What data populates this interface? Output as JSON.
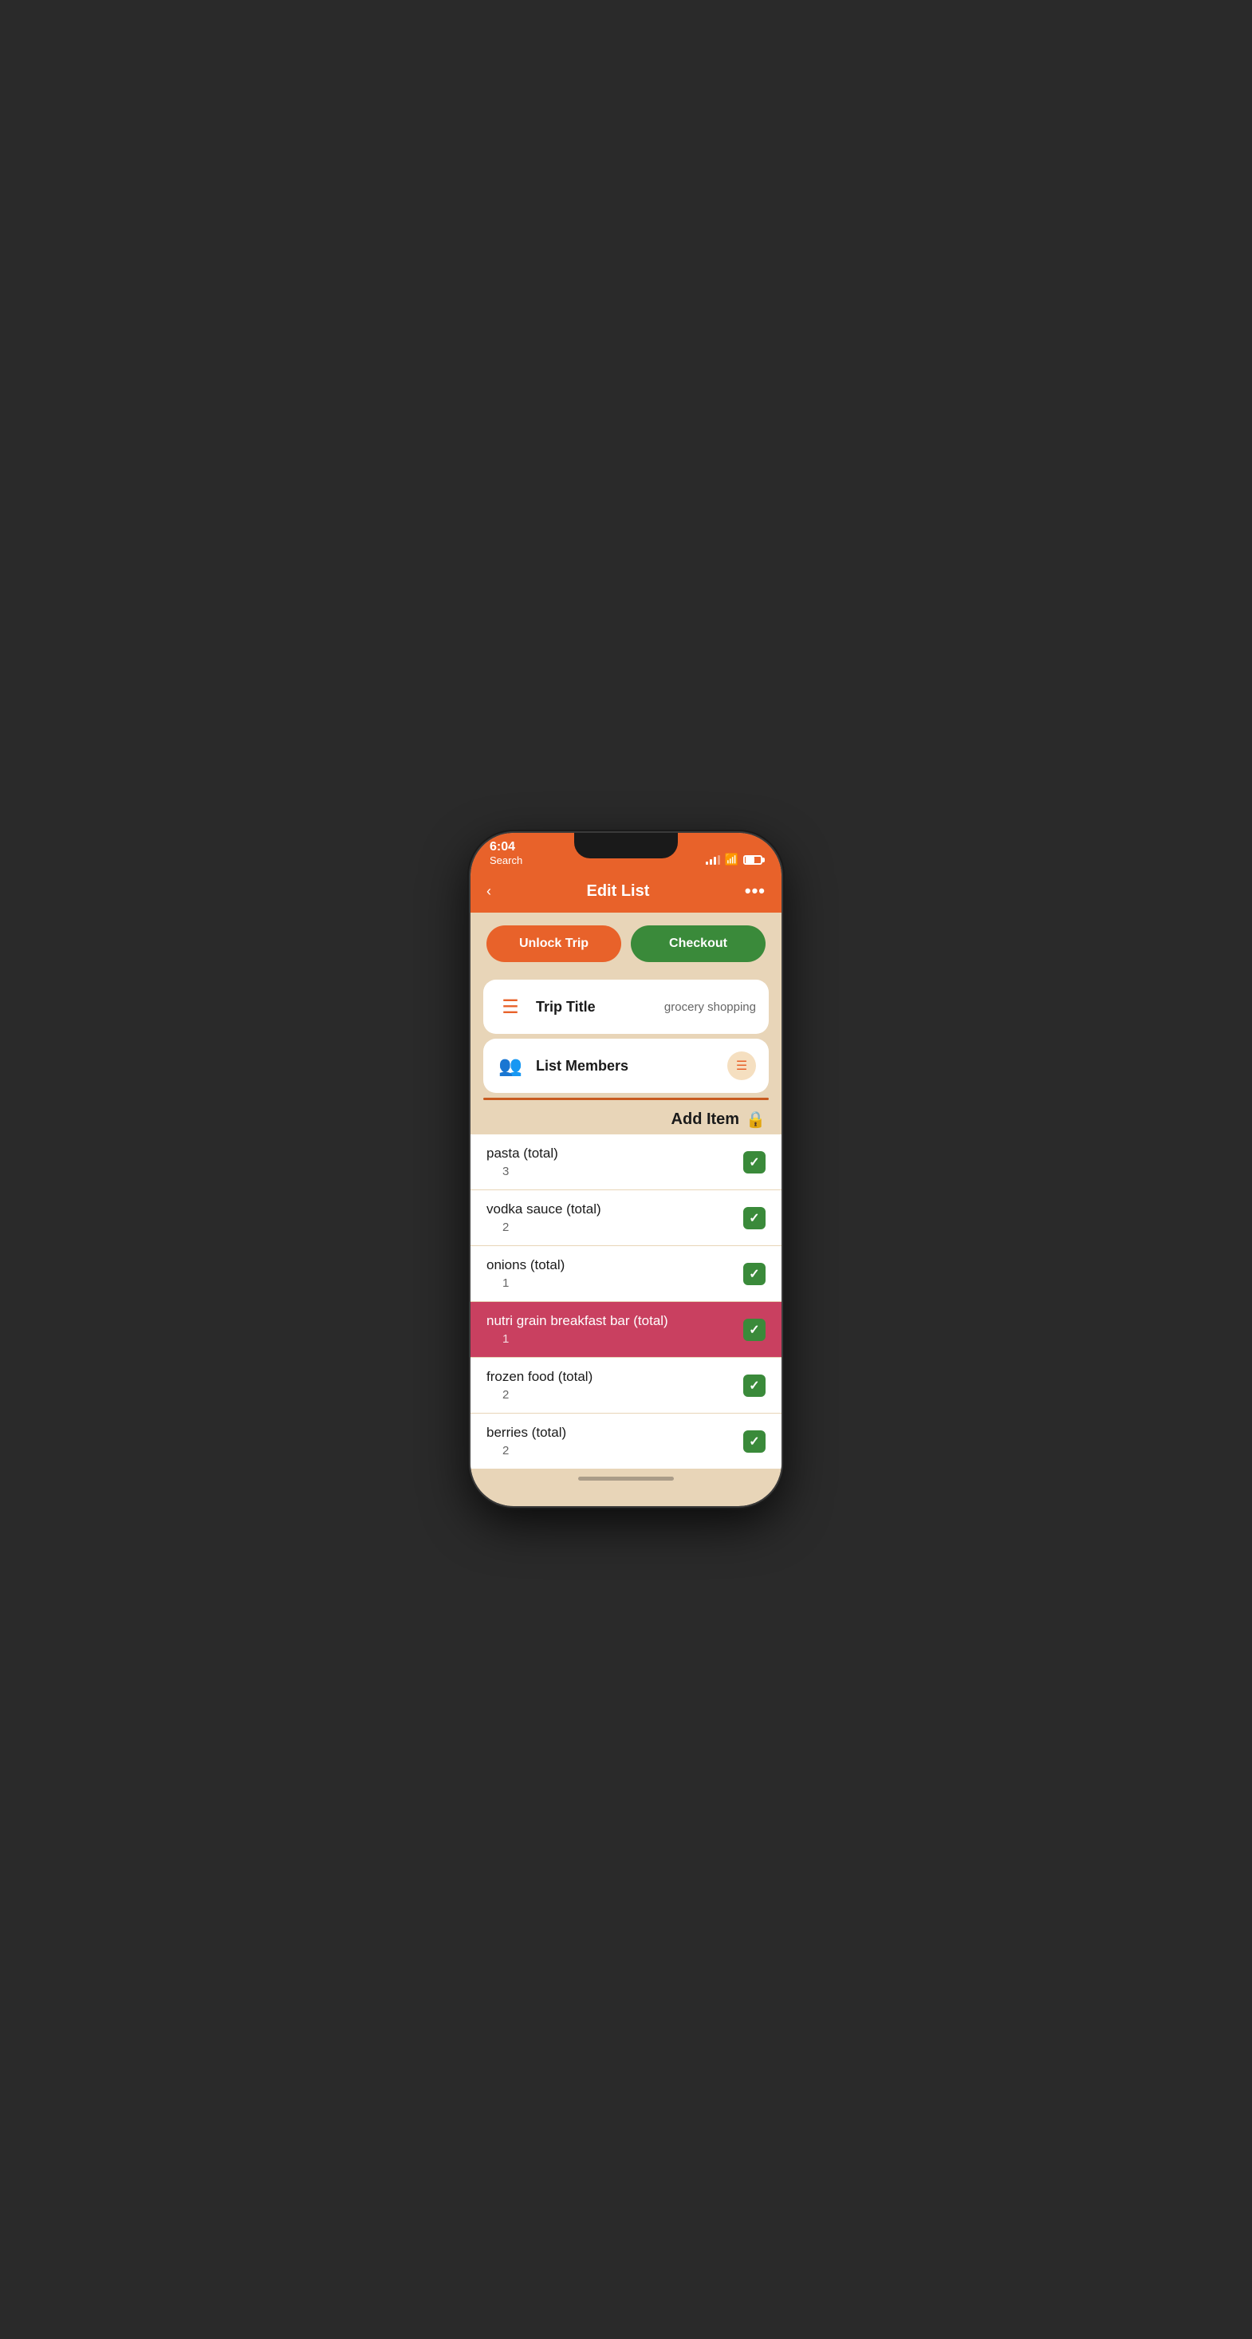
{
  "statusBar": {
    "time": "6:04",
    "backLabel": "Search"
  },
  "header": {
    "title": "Edit List",
    "backArrow": "‹",
    "moreIcon": "•••"
  },
  "buttons": {
    "unlock": "Unlock Trip",
    "checkout": "Checkout"
  },
  "tripTitle": {
    "label": "Trip Title",
    "value": "grocery shopping"
  },
  "listMembers": {
    "label": "List Members"
  },
  "addItem": {
    "label": "Add Item"
  },
  "items": [
    {
      "name": "pasta (total)",
      "quantity": "3",
      "checked": true,
      "highlighted": false
    },
    {
      "name": "vodka sauce (total)",
      "quantity": "2",
      "checked": true,
      "highlighted": false
    },
    {
      "name": "onions (total)",
      "quantity": "1",
      "checked": true,
      "highlighted": false
    },
    {
      "name": "nutri grain breakfast bar (total)",
      "quantity": "1",
      "checked": true,
      "highlighted": true
    },
    {
      "name": "frozen food (total)",
      "quantity": "2",
      "checked": true,
      "highlighted": false
    },
    {
      "name": "berries (total)",
      "quantity": "2",
      "checked": true,
      "highlighted": false
    }
  ]
}
